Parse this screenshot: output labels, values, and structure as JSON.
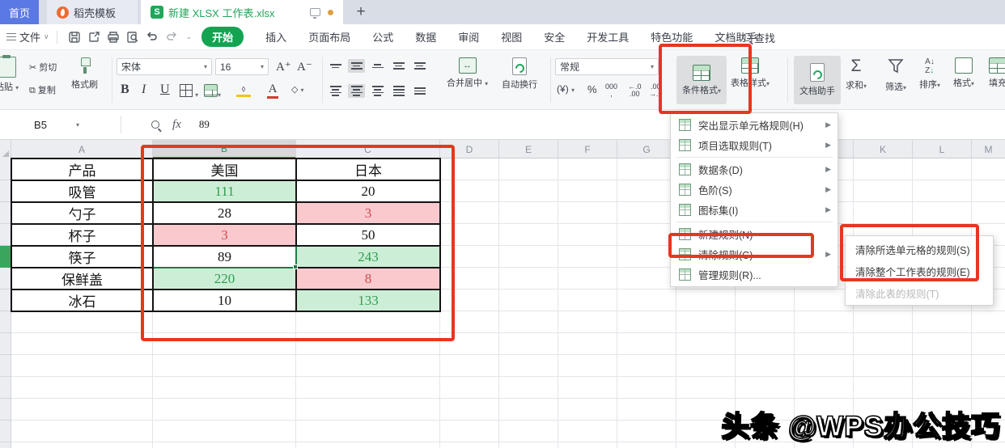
{
  "tab_bar": {
    "tabs": [
      {
        "label": "首页"
      },
      {
        "label": "稻壳模板"
      },
      {
        "label": "新建 XLSX 工作表.xlsx"
      }
    ],
    "new_tab_label": "+"
  },
  "menu_bar": {
    "file_label": "文件",
    "items": [
      {
        "label": "开始",
        "active": true
      },
      {
        "label": "插入"
      },
      {
        "label": "页面布局"
      },
      {
        "label": "公式"
      },
      {
        "label": "数据"
      },
      {
        "label": "审阅"
      },
      {
        "label": "视图"
      },
      {
        "label": "安全"
      },
      {
        "label": "开发工具"
      },
      {
        "label": "特色功能"
      },
      {
        "label": "文档助手"
      }
    ],
    "search_label": "查找"
  },
  "toolbar": {
    "paste_label": "粘贴",
    "cut_label": "剪切",
    "copy_label": "复制",
    "format_painter_label": "格式刷",
    "font_name": "宋体",
    "font_size": "16",
    "bold_label": "B",
    "italic_label": "I",
    "underline_label": "U",
    "font_grow_label": "A⁺",
    "font_shrink_label": "A⁻",
    "merge_center_label": "合并居中",
    "wrap_text_label": "自动换行",
    "number_format_value": "常规",
    "currency_label": "¥",
    "percent_label": "%",
    "thousands_label": "000",
    "dec_decrease_label": "←.0",
    "dec_increase_label": ".00",
    "conditional_format_label": "条件格式",
    "table_style_label": "表格样式",
    "doc_assistant_label": "文档助手",
    "sum_label": "求和",
    "filter_label": "筛选",
    "sort_label": "排序",
    "format_label": "格式",
    "fill_label": "填充"
  },
  "formula_bar": {
    "name_box_value": "B5",
    "fx_label": "fx",
    "cell_value": "89"
  },
  "sheet": {
    "col_headers": [
      "A",
      "B",
      "C",
      "D",
      "E",
      "F",
      "G",
      "H",
      "I",
      "J",
      "K",
      "L",
      "M"
    ],
    "selected_col": "B",
    "selected_cell": "B5",
    "table_rows": [
      {
        "cells": [
          {
            "t": "产品",
            "s": "none"
          },
          {
            "t": "美国",
            "s": "none"
          },
          {
            "t": "日本",
            "s": "none"
          }
        ]
      },
      {
        "cells": [
          {
            "t": "吸管",
            "s": "none"
          },
          {
            "t": "111",
            "s": "green"
          },
          {
            "t": "20",
            "s": "none"
          }
        ]
      },
      {
        "cells": [
          {
            "t": "勺子",
            "s": "none"
          },
          {
            "t": "28",
            "s": "none"
          },
          {
            "t": "3",
            "s": "pink"
          }
        ]
      },
      {
        "cells": [
          {
            "t": "杯子",
            "s": "none"
          },
          {
            "t": "3",
            "s": "pink"
          },
          {
            "t": "50",
            "s": "none"
          }
        ]
      },
      {
        "cells": [
          {
            "t": "筷子",
            "s": "none"
          },
          {
            "t": "89",
            "s": "selected"
          },
          {
            "t": "243",
            "s": "green"
          }
        ]
      },
      {
        "cells": [
          {
            "t": "保鲜盖",
            "s": "none"
          },
          {
            "t": "220",
            "s": "green"
          },
          {
            "t": "8",
            "s": "pink"
          }
        ]
      },
      {
        "cells": [
          {
            "t": "冰石",
            "s": "none"
          },
          {
            "t": "10",
            "s": "none"
          },
          {
            "t": "133",
            "s": "green"
          }
        ]
      }
    ]
  },
  "conditional_format_menu": {
    "items": [
      {
        "label": "突出显示单元格规则(H)",
        "icon": "highlight-cells-rules-icon",
        "arrow": true
      },
      {
        "label": "项目选取规则(T)",
        "icon": "top-bottom-rules-icon",
        "arrow": true,
        "sep_after": true
      },
      {
        "label": "数据条(D)",
        "icon": "data-bars-icon",
        "arrow": true
      },
      {
        "label": "色阶(S)",
        "icon": "color-scales-icon",
        "arrow": true
      },
      {
        "label": "图标集(I)",
        "icon": "icon-sets-icon",
        "arrow": true,
        "sep_after": true
      },
      {
        "label": "新建规则(N)",
        "icon": "new-rule-icon",
        "arrow": false
      },
      {
        "label": "清除规则(C)",
        "icon": "clear-rules-icon",
        "arrow": true
      },
      {
        "label": "管理规则(R)...",
        "icon": "manage-rules-icon",
        "arrow": false
      }
    ]
  },
  "clear_rules_submenu": {
    "items": [
      {
        "label": "清除所选单元格的规则(S)",
        "disabled": false
      },
      {
        "label": "清除整个工作表的规则(E)",
        "disabled": false
      },
      {
        "label": "清除此表的规则(T)",
        "disabled": true
      }
    ]
  },
  "watermark_text": "头条 @WPS办公技巧",
  "colors": {
    "annotation_red": "#e6371f",
    "wps_green": "#21a65c",
    "active_menu_pill": "#13a452",
    "cell_green_bg": "#cdeed6",
    "cell_green_text": "#2f9e52",
    "cell_pink_bg": "#f9c9cd",
    "cell_pink_text": "#d4494f",
    "selection_border": "#1c7d45",
    "home_tab_blue": "#5b79e3"
  }
}
